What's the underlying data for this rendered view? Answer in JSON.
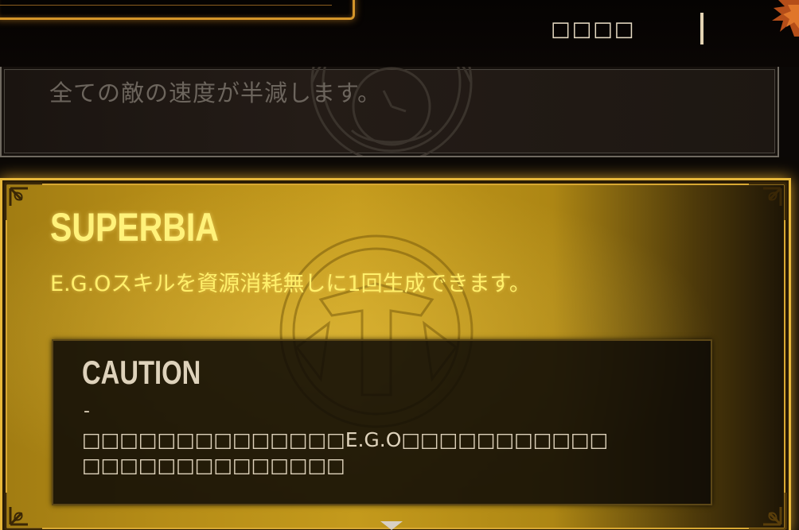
{
  "header": {
    "label": "□□□□"
  },
  "previous_card": {
    "description": "全ての敵の速度が半減します。"
  },
  "selected_card": {
    "title": "SUPERBIA",
    "description": "E.G.Oスキルを資源消耗無しに1回生成できます。",
    "caution": {
      "title": "CAUTION",
      "dash": "-",
      "line1": "□□□□□□□□□□□□□□E.G.O□□□□□□□□□□□",
      "line2": "□□□□□□□□□□□□□□"
    }
  },
  "colors": {
    "gold_accent": "#e8b83a",
    "title_yellow": "#fff27a",
    "caution_text": "#ded2bb"
  }
}
